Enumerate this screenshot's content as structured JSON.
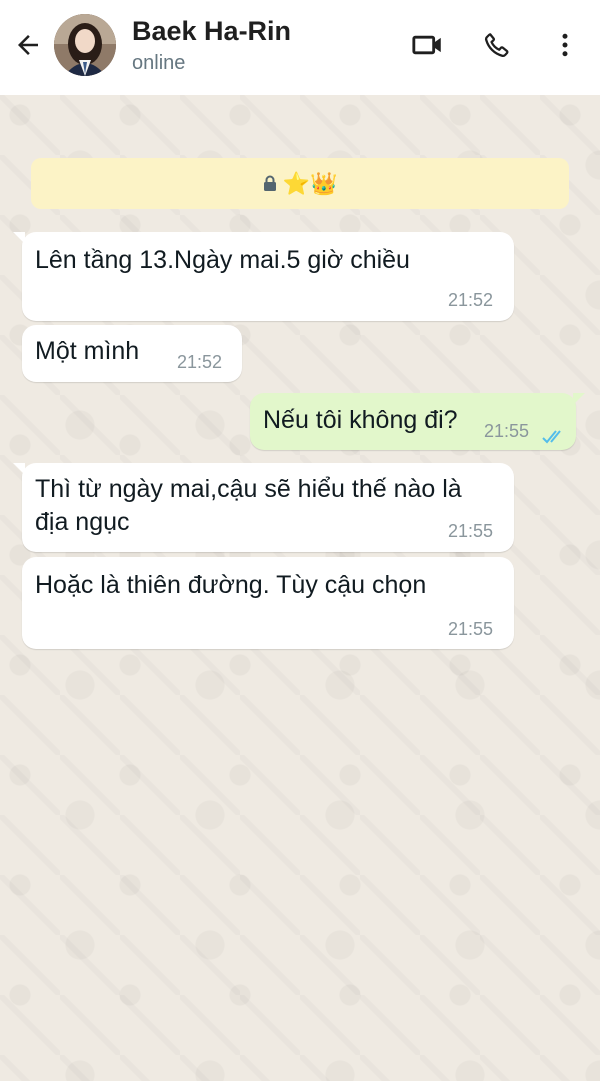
{
  "header": {
    "back_icon": "arrow-left-icon",
    "contact_name": "Baek Ha-Rin",
    "status": "online",
    "video_icon": "video-call-icon",
    "call_icon": "phone-icon",
    "menu_icon": "more-vertical-icon"
  },
  "banner": {
    "lock_glyph": "🔒",
    "emoji": "⭐👑"
  },
  "messages": [
    {
      "direction": "incoming",
      "text": "Lên tầng 13.Ngày mai.5 giờ chiều",
      "time": "21:52"
    },
    {
      "direction": "incoming",
      "text": "Một mình",
      "time": "21:52"
    },
    {
      "direction": "outgoing",
      "text": "Nếu tôi không đi?",
      "time": "21:55",
      "status": "read"
    },
    {
      "direction": "incoming",
      "text": "Thì từ ngày mai,cậu sẽ hiểu thế nào là\nđịa ngục",
      "time": "21:55"
    },
    {
      "direction": "incoming",
      "text": "Hoặc là thiên đường. Tùy cậu chọn",
      "time": "21:55"
    }
  ],
  "colors": {
    "incoming_bubble": "#ffffff",
    "outgoing_bubble": "#e2f7cb",
    "read_ticks": "#53bdeb",
    "chat_background": "#efeae2",
    "banner": "#fcf3c6"
  }
}
